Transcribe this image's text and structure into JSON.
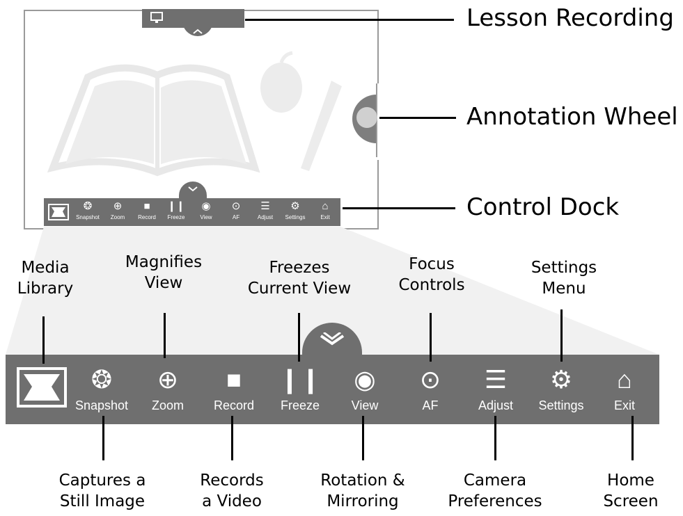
{
  "callouts": {
    "lesson_recording": "Lesson Recording",
    "annotation_wheel": "Annotation Wheel",
    "control_dock": "Control Dock"
  },
  "top_labels": {
    "media_library": [
      "Media",
      "Library"
    ],
    "magnifies_view": [
      "Magnifies",
      "View"
    ],
    "freezes_view": [
      "Freezes",
      "Current View"
    ],
    "focus_controls": [
      "Focus",
      "Controls"
    ],
    "settings_menu": [
      "Settings",
      "Menu"
    ]
  },
  "bottom_labels": {
    "captures": [
      "Captures a",
      "Still Image"
    ],
    "records": [
      "Records",
      "a Video"
    ],
    "rotation": [
      "Rotation &",
      "Mirroring"
    ],
    "camera": [
      "Camera",
      "Preferences"
    ],
    "home": [
      "Home",
      "Screen"
    ]
  },
  "dock_items": {
    "snapshot": "Snapshot",
    "zoom": "Zoom",
    "record": "Record",
    "freeze": "Freeze",
    "view": "View",
    "af": "AF",
    "adjust": "Adjust",
    "settings": "Settings",
    "exit": "Exit"
  },
  "icons": {
    "media": "media-library-icon",
    "snapshot": "aperture-icon",
    "zoom": "zoom-in-icon",
    "record": "video-camera-icon",
    "freeze": "pause-icon",
    "view": "eye-icon",
    "af": "crosshair-icon",
    "adjust": "sliders-icon",
    "settings": "gear-icon",
    "exit": "home-icon",
    "lesson": "monitor-icon",
    "collapse": "chevron-icon",
    "annotation": "pen-icon"
  },
  "colors": {
    "dock": "#6f6f6f",
    "wallpaper": "#ececec",
    "text": "#000000"
  }
}
